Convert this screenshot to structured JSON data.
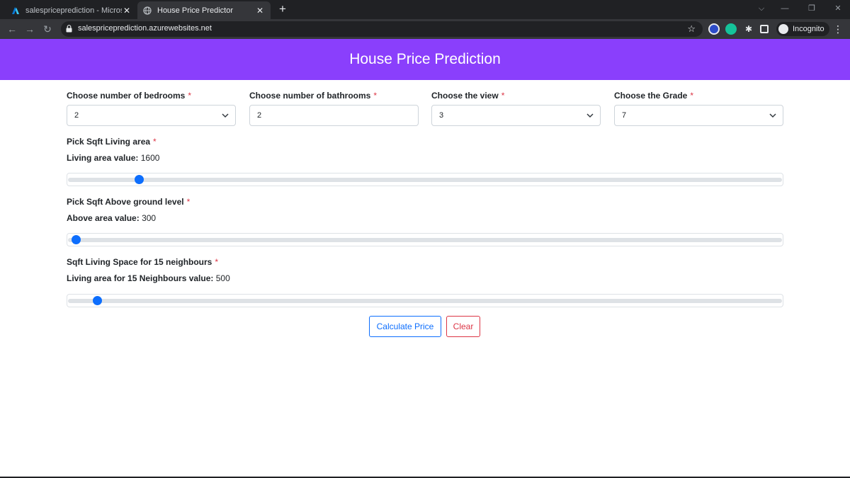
{
  "browser": {
    "tabs": [
      {
        "title": "salespriceprediction - Microsoft Azure"
      },
      {
        "title": "House Price Predictor"
      }
    ],
    "url": "salespriceprediction.azurewebsites.net",
    "profile_label": "Incognito"
  },
  "app": {
    "title": "House Price Prediction"
  },
  "form": {
    "bedrooms": {
      "label": "Choose number of bedrooms",
      "value": "2"
    },
    "bathrooms": {
      "label": "Choose number of bathrooms",
      "value": "2"
    },
    "view": {
      "label": "Choose the view",
      "value": "3"
    },
    "grade": {
      "label": "Choose the Grade",
      "value": "7"
    },
    "required_marker": "*",
    "living_area": {
      "label": "Pick Sqft Living area",
      "value_label": "Living area value:",
      "value": "1600",
      "slider_fraction": 0.095
    },
    "above_ground": {
      "label": "Pick Sqft Above ground level",
      "value_label": "Above area value:",
      "value": "300",
      "slider_fraction": 0.006
    },
    "neighbours": {
      "label": "Sqft Living Space for 15 neighbours",
      "value_label": "Living area for 15 Neighbours value:",
      "value": "500",
      "slider_fraction": 0.036
    }
  },
  "buttons": {
    "calculate": "Calculate Price",
    "clear": "Clear"
  },
  "colors": {
    "header_bg": "#8a3ffc",
    "primary": "#0d6efd",
    "danger": "#dc3545"
  }
}
